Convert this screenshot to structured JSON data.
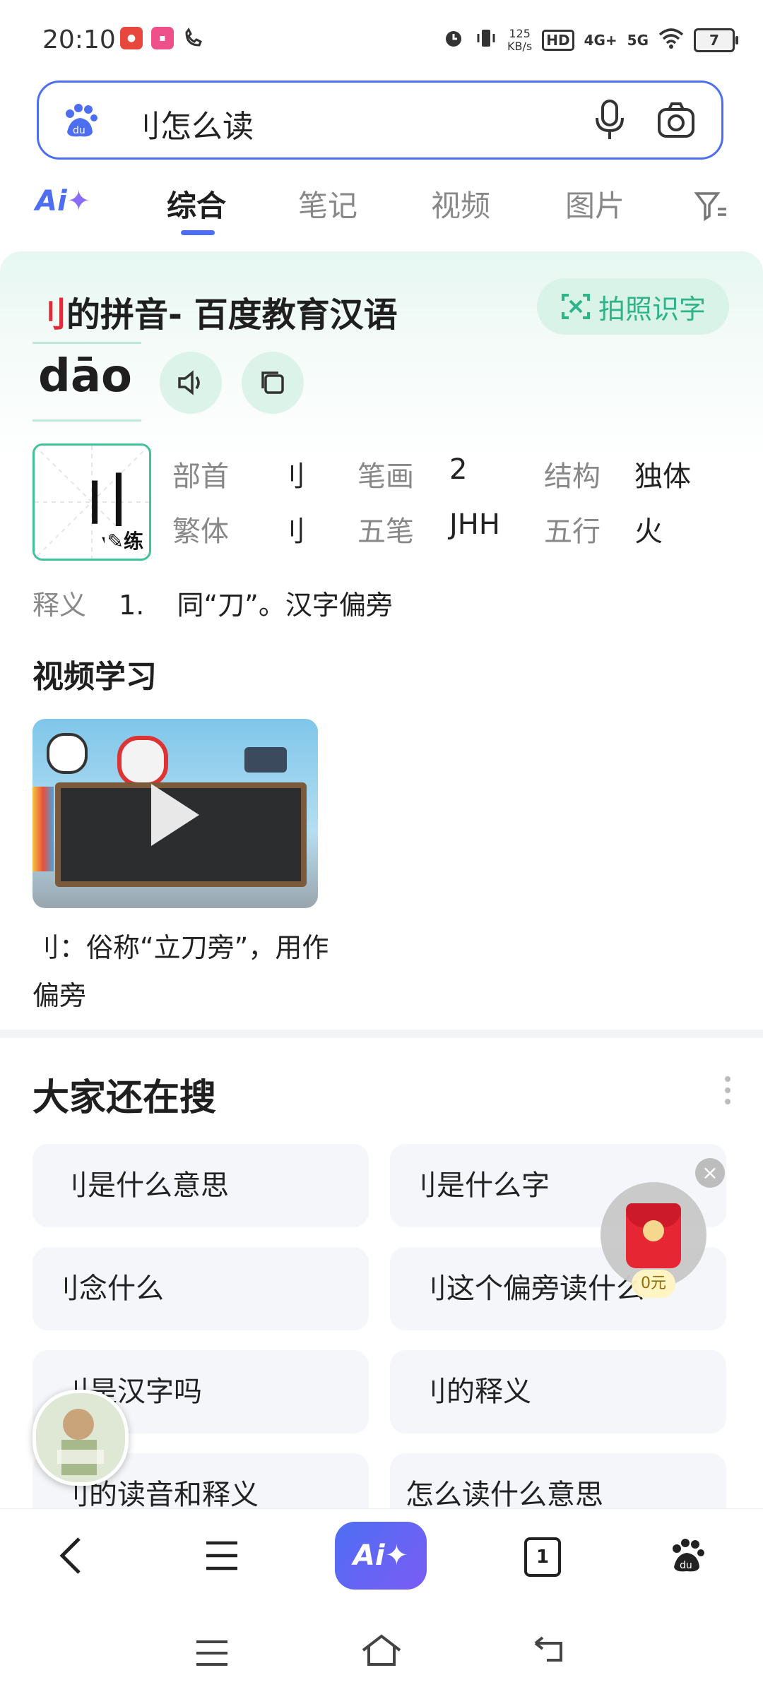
{
  "status_bar": {
    "time": "20:10",
    "net_speed": "125",
    "net_speed_unit": "KB/s",
    "hd": "HD",
    "sim1": "4G+",
    "sim2": "5G",
    "battery": "7"
  },
  "search": {
    "query": "刂怎么读"
  },
  "tabs": {
    "ai": "Ai",
    "items": [
      {
        "label": "综合"
      },
      {
        "label": "笔记"
      },
      {
        "label": "视频"
      },
      {
        "label": "图片"
      }
    ]
  },
  "card": {
    "title_char": "刂",
    "title_rest": "的拼音- 百度教育汉语",
    "photo_btn": "拍照识字",
    "pinyin": "dāo",
    "char_glyph": "刂",
    "practice": "练",
    "info": {
      "radical_k": "部首",
      "radical_v": "刂",
      "strokes_k": "笔画",
      "strokes_v": "2",
      "structure_k": "结构",
      "structure_v": "独体",
      "traditional_k": "繁体",
      "traditional_v": "刂",
      "wubi_k": "五笔",
      "wubi_v": "JHH",
      "wuxing_k": "五行",
      "wuxing_v": "火"
    },
    "meaning_k": "释义",
    "meaning_num": "1.",
    "meaning_text": "同“刀”。汉字偏旁",
    "video_title": "视频学习",
    "video_caption": "刂：俗称“立刀旁”，用作偏旁"
  },
  "also_searched": {
    "title": "大家还在搜",
    "items": [
      {
        "label": "刂是什么意思"
      },
      {
        "label": "刂是什么字"
      },
      {
        "label": "刂念什么"
      },
      {
        "label": "刂这个偏旁读什么"
      },
      {
        "label": "刂是汉字吗"
      },
      {
        "label": "刂的释义"
      },
      {
        "label": "刂的读音和释义"
      },
      {
        "label": "怎么读什么意思"
      }
    ]
  },
  "floating": {
    "redpack_amount": "0元"
  },
  "bottom_bar": {
    "ai": "Ai",
    "tab_count": "1"
  },
  "colors": {
    "accent": "#4e6ef2",
    "green": "#2fb388",
    "red": "#e4293a"
  }
}
